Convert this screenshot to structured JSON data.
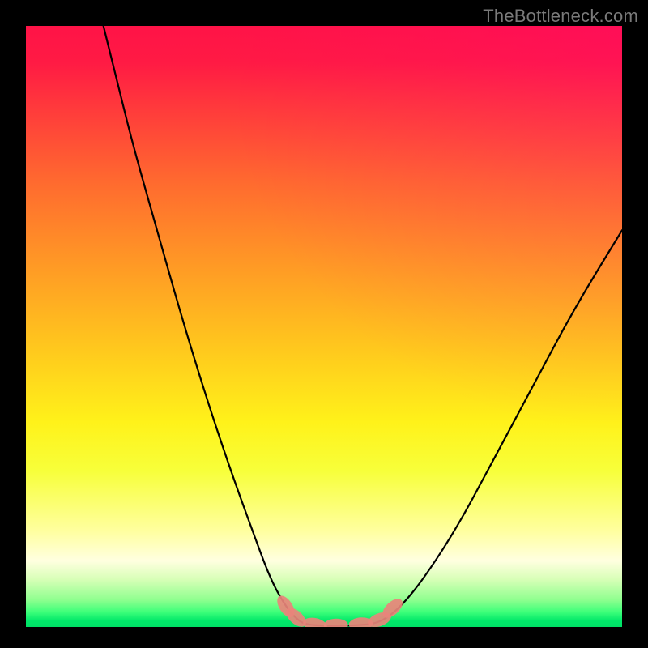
{
  "watermark": "TheBottleneck.com",
  "chart_data": {
    "type": "line",
    "title": "",
    "xlabel": "",
    "ylabel": "",
    "xlim": [
      0,
      100
    ],
    "ylim": [
      0,
      100
    ],
    "grid": false,
    "legend": false,
    "series": [
      {
        "name": "left-curve",
        "x": [
          13,
          15,
          18,
          22,
          26,
          30,
          34,
          38,
          41,
          43.5,
          45.5,
          47
        ],
        "y": [
          100,
          92,
          80,
          66,
          52,
          39,
          27,
          16,
          8,
          3.5,
          1.2,
          0.4
        ]
      },
      {
        "name": "flat-minimum",
        "x": [
          47,
          50,
          53,
          56,
          59
        ],
        "y": [
          0.4,
          0.2,
          0.2,
          0.3,
          0.6
        ]
      },
      {
        "name": "right-curve",
        "x": [
          59,
          62,
          66,
          72,
          78,
          85,
          92,
          100
        ],
        "y": [
          0.6,
          2.5,
          7,
          16,
          27,
          40,
          53,
          66
        ]
      }
    ],
    "markers": [
      {
        "name": "left-blob-upper",
        "x": 43.6,
        "y": 3.4
      },
      {
        "name": "left-blob-lower",
        "x": 45.3,
        "y": 1.6
      },
      {
        "name": "flat-blob-1",
        "x": 48.5,
        "y": 0.4
      },
      {
        "name": "flat-blob-2",
        "x": 52.0,
        "y": 0.3
      },
      {
        "name": "flat-blob-3",
        "x": 56.2,
        "y": 0.5
      },
      {
        "name": "right-blob-lower",
        "x": 59.3,
        "y": 1.2
      },
      {
        "name": "right-blob-upper",
        "x": 61.5,
        "y": 3.1
      }
    ],
    "colors": {
      "curve": "#000000",
      "marker_fill": "#e9847b",
      "gradient_top": "#ff1347",
      "gradient_mid": "#fff21a",
      "gradient_bottom": "#00e066"
    }
  }
}
